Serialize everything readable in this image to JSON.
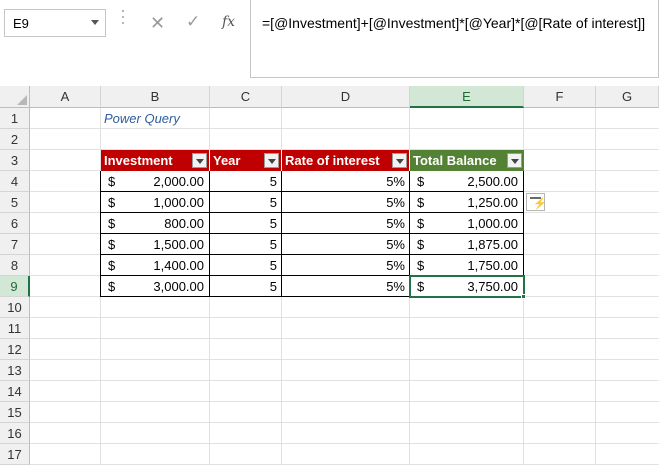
{
  "name_box": "E9",
  "formula_bar": {
    "cancel_icon": "✕",
    "enter_icon": "✓",
    "fx_label": "fx",
    "formula": "=[@Investment]+[@Investment]*[@Year]*[@[Rate of interest]]"
  },
  "columns": [
    "A",
    "B",
    "C",
    "D",
    "E",
    "F",
    "G"
  ],
  "rows": [
    "1",
    "2",
    "3",
    "4",
    "5",
    "6",
    "7",
    "8",
    "9",
    "10",
    "11",
    "12",
    "13",
    "14",
    "15",
    "16",
    "17"
  ],
  "sheet_title": "Power Query",
  "table": {
    "headers": [
      "Investment",
      "Year",
      "Rate of interest",
      "Total Balance"
    ],
    "header_colors": {
      "red": "#C00000",
      "green": "#548235"
    },
    "currency_symbol": "$",
    "rows": [
      {
        "investment": "2,000.00",
        "year": "5",
        "rate": "5%",
        "total": "2,500.00"
      },
      {
        "investment": "1,000.00",
        "year": "5",
        "rate": "5%",
        "total": "1,250.00"
      },
      {
        "investment": "800.00",
        "year": "5",
        "rate": "5%",
        "total": "1,000.00"
      },
      {
        "investment": "1,500.00",
        "year": "5",
        "rate": "5%",
        "total": "1,875.00"
      },
      {
        "investment": "1,400.00",
        "year": "5",
        "rate": "5%",
        "total": "1,750.00"
      },
      {
        "investment": "3,000.00",
        "year": "5",
        "rate": "5%",
        "total": "3,750.00"
      }
    ]
  },
  "selection_color": "#217346",
  "icons": {
    "quick_analysis": "quick-analysis-icon",
    "filter_dropdown": "filter-dropdown-icon"
  }
}
